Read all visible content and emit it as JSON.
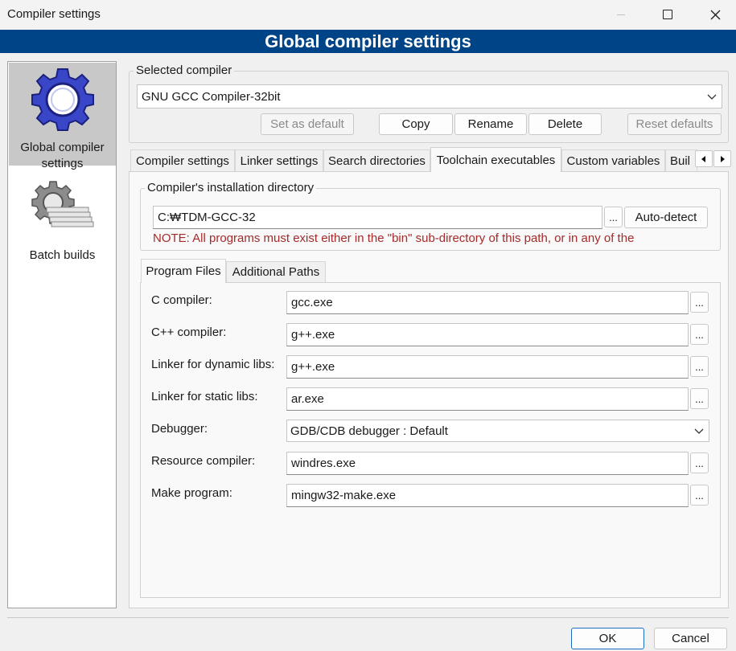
{
  "window": {
    "title": "Compiler settings"
  },
  "header": {
    "title": "Global compiler settings"
  },
  "sidebar": {
    "items": [
      {
        "label_line1": "Global compiler",
        "label_line2": "settings",
        "icon": "gear-blue-icon"
      },
      {
        "label": "Batch builds",
        "icon": "gear-grey-icon"
      }
    ]
  },
  "compiler_group": {
    "legend": "Selected compiler",
    "selected": "GNU GCC Compiler-32bit",
    "set_default": "Set as default",
    "copy": "Copy",
    "rename": "Rename",
    "delete": "Delete",
    "reset_defaults": "Reset defaults"
  },
  "tabs": [
    {
      "label": "Compiler settings"
    },
    {
      "label": "Linker settings"
    },
    {
      "label": "Search directories"
    },
    {
      "label": "Toolchain executables"
    },
    {
      "label": "Custom variables"
    },
    {
      "label": "Buil"
    }
  ],
  "install_dir": {
    "legend": "Compiler's installation directory",
    "value": "C:₩TDM-GCC-32",
    "browse": "...",
    "auto_detect": "Auto-detect",
    "note": "NOTE: All programs must exist either in the \"bin\" sub-directory of this path, or in any of the"
  },
  "subtabs": [
    {
      "label": "Program Files"
    },
    {
      "label": "Additional Paths"
    }
  ],
  "programs": {
    "c_compiler": {
      "label": "C compiler:",
      "value": "gcc.exe"
    },
    "cpp_compiler": {
      "label": "C++ compiler:",
      "value": "g++.exe"
    },
    "linker_dynamic": {
      "label": "Linker for dynamic libs:",
      "value": "g++.exe"
    },
    "linker_static": {
      "label": "Linker for static libs:",
      "value": "ar.exe"
    },
    "debugger": {
      "label": "Debugger:",
      "value": "GDB/CDB debugger : Default"
    },
    "resource_compiler": {
      "label": "Resource compiler:",
      "value": "windres.exe"
    },
    "make_program": {
      "label": "Make program:",
      "value": "mingw32-make.exe"
    },
    "browse": "..."
  },
  "footer": {
    "ok": "OK",
    "cancel": "Cancel"
  },
  "colors": {
    "header_bg": "#004488",
    "note": "#a52a2a",
    "selected_item": "#c8c8c8"
  }
}
